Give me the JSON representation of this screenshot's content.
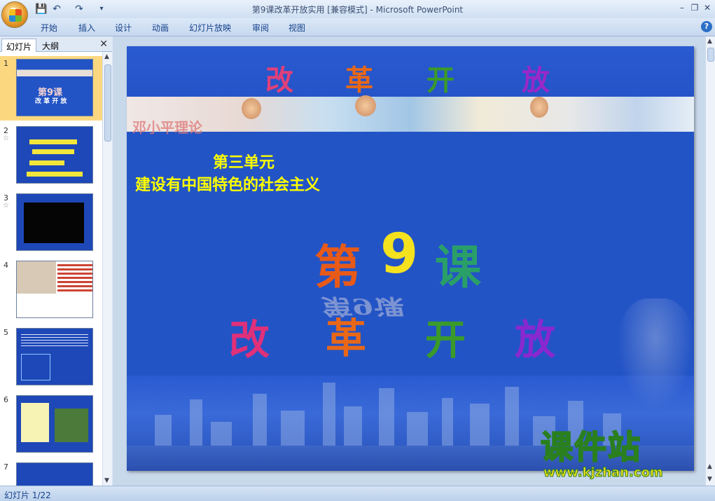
{
  "window": {
    "title": "第9课改革开放实用 [兼容模式] - Microsoft PowerPoint"
  },
  "ribbon": {
    "tabs": [
      "开始",
      "插入",
      "设计",
      "动画",
      "幻灯片放映",
      "审阅",
      "视图"
    ]
  },
  "left_pane": {
    "tab_slides": "幻灯片",
    "tab_outline": "大纲",
    "thumbnails": [
      {
        "number": "1",
        "selected": true,
        "has_anim": false,
        "title": "第9课",
        "subtitle": "改 革 开 放"
      },
      {
        "number": "2",
        "selected": false,
        "has_anim": true
      },
      {
        "number": "3",
        "selected": false,
        "has_anim": true
      },
      {
        "number": "4",
        "selected": false,
        "has_anim": false
      },
      {
        "number": "5",
        "selected": false,
        "has_anim": false
      },
      {
        "number": "6",
        "selected": false,
        "has_anim": false
      },
      {
        "number": "7",
        "selected": false,
        "has_anim": false
      }
    ]
  },
  "slide": {
    "top_chars": [
      "改",
      "革",
      "开",
      "放"
    ],
    "theory": "邓小平理论",
    "unit_label": "第三单元",
    "unit_title": "建设有中国特色的社会主义",
    "lesson_di": "第",
    "lesson_num": "9",
    "lesson_ke": "课",
    "lesson_reflection": "第9课",
    "big_chars": [
      "改",
      "革",
      "开",
      "放"
    ]
  },
  "watermark": {
    "title": "课件站",
    "url": "www.kjzhan.com"
  },
  "status": {
    "slide_counter": "幻灯片 1/22"
  },
  "colors": {
    "slide_bg": "#2354c6",
    "unit_text": "#ffff00",
    "selected_thumb": "#fbd880"
  }
}
